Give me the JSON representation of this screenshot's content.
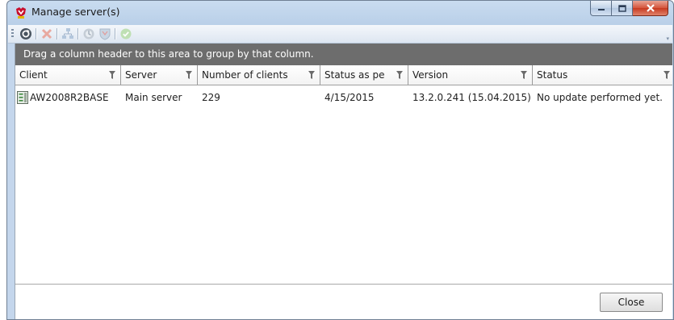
{
  "window": {
    "title": "Manage server(s)"
  },
  "toolbar": {
    "icons": [
      "refresh-icon",
      "delete-icon",
      "network-icon",
      "update-icon",
      "shield-icon",
      "checkmark-icon"
    ]
  },
  "group_panel": {
    "hint": "Drag a column header to this area to group by that column."
  },
  "grid": {
    "columns": [
      "Client",
      "Server",
      "Number of clients",
      "Status as pe",
      "Version",
      "Status"
    ],
    "rows": [
      {
        "client": "AW2008R2BASE",
        "server": "Main server",
        "clients": "229",
        "status_as_per": "4/15/2015",
        "version": "13.2.0.241 (15.04.2015)",
        "status": "No update performed yet."
      }
    ]
  },
  "footer": {
    "close_label": "Close"
  },
  "colors": {
    "group_panel": "#6d6d6d",
    "title_bar": "#c9dcf0",
    "close_button_red": "#c73a20"
  }
}
